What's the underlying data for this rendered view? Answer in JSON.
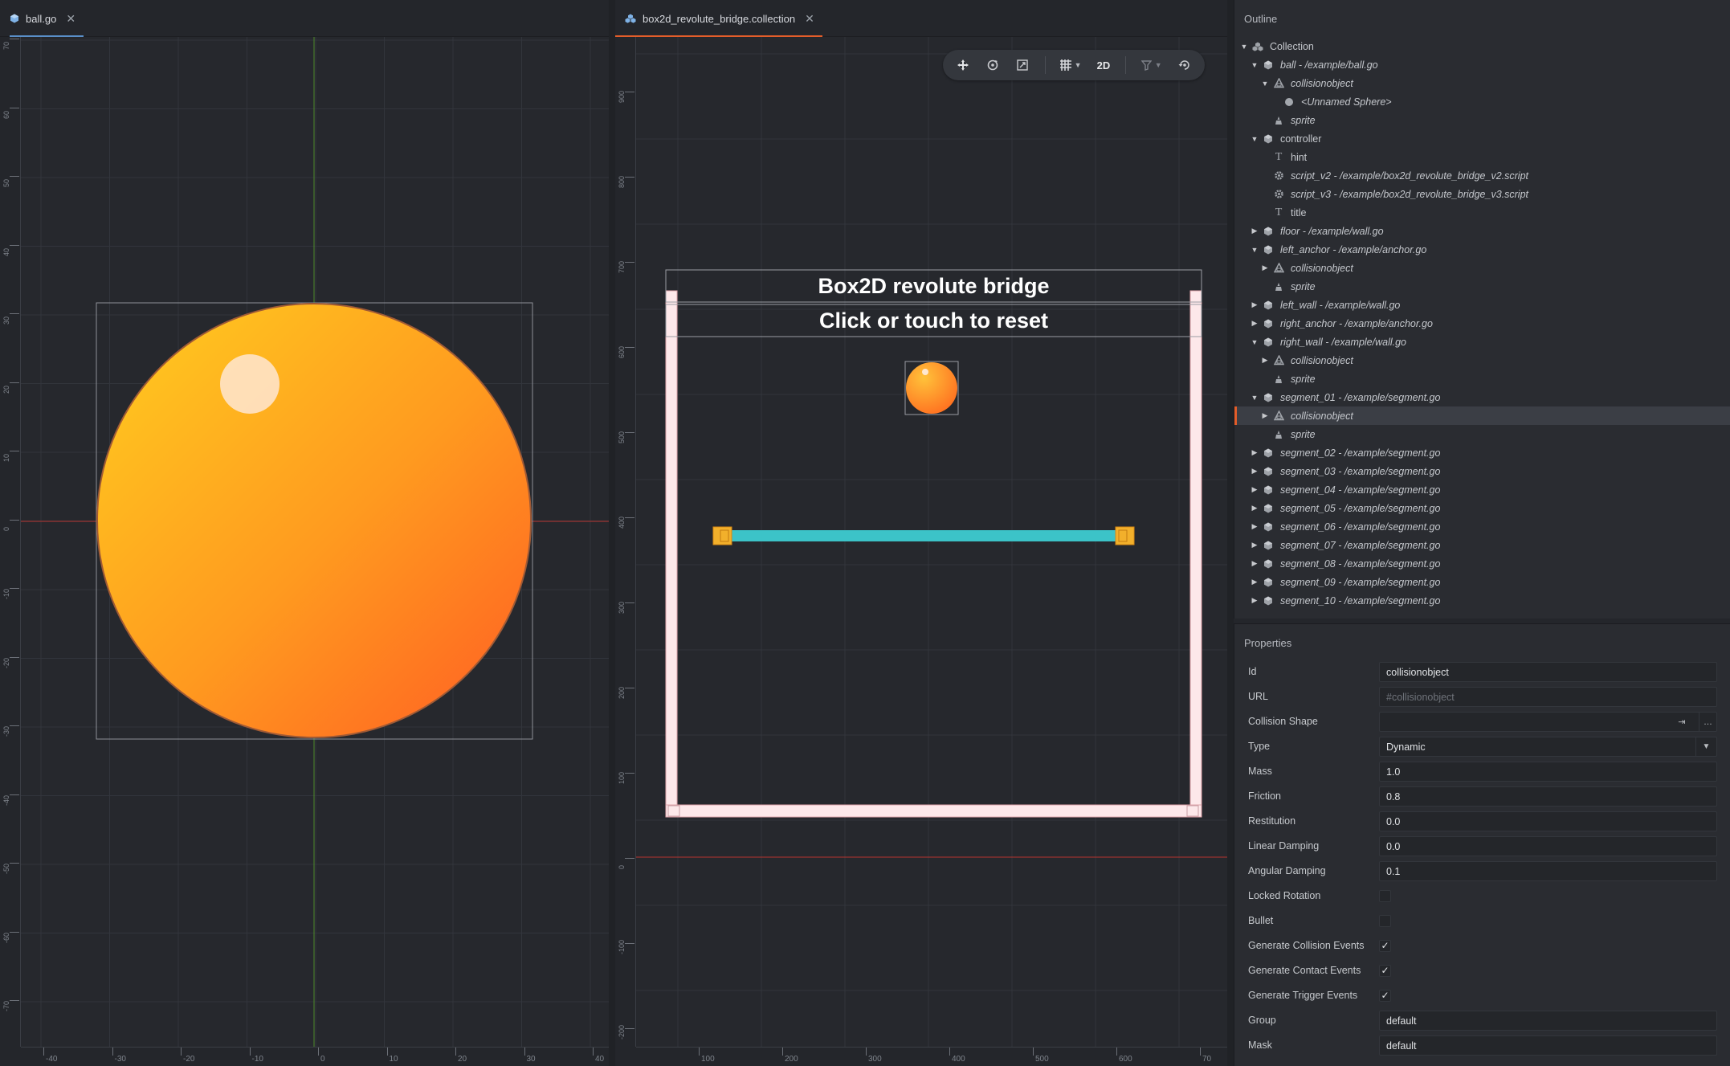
{
  "tabs": {
    "ball": {
      "label": "ball.go",
      "close": "✕"
    },
    "collection": {
      "label": "box2d_revolute_bridge.collection",
      "close": "✕"
    }
  },
  "ball_view": {
    "ruler_y": [
      "70",
      "60",
      "50",
      "40",
      "30",
      "20",
      "10",
      "0",
      "-10",
      "-20",
      "-30",
      "-40",
      "-50",
      "-60",
      "-70"
    ],
    "ruler_x": [
      "-40",
      "-30",
      "-20",
      "-10",
      "0",
      "10",
      "20",
      "30",
      "40"
    ]
  },
  "collection_view": {
    "ruler_y": [
      "900",
      "800",
      "700",
      "600",
      "500",
      "400",
      "300",
      "200",
      "100",
      "0",
      "-100",
      "-200"
    ],
    "ruler_x": [
      "100",
      "200",
      "300",
      "400",
      "500",
      "600",
      "70"
    ],
    "game_title": "Box2D revolute bridge",
    "game_hint": "Click or touch to reset"
  },
  "toolbar": {
    "move_icon": "move-icon",
    "rotate_icon": "rotate-icon",
    "scale_icon": "scale-icon",
    "grid_icon": "grid-icon",
    "mode_label": "2D",
    "visibility_icon": "filter-icon",
    "camera_icon": "camera-reset-icon"
  },
  "outline": {
    "title": "Outline",
    "items": [
      {
        "label": "Collection",
        "depth": 0,
        "arrow": "▼",
        "icon": "collection",
        "italic": false
      },
      {
        "label": "ball - /example/ball.go",
        "depth": 1,
        "arrow": "▼",
        "icon": "go",
        "italic": true
      },
      {
        "label": "collisionobject",
        "depth": 2,
        "arrow": "▼",
        "icon": "collision",
        "italic": true
      },
      {
        "label": "<Unnamed Sphere>",
        "depth": 3,
        "arrow": "",
        "icon": "sphere",
        "italic": true
      },
      {
        "label": "sprite",
        "depth": 2,
        "arrow": "",
        "icon": "sprite",
        "italic": true
      },
      {
        "label": "controller",
        "depth": 1,
        "arrow": "▼",
        "icon": "go",
        "italic": false
      },
      {
        "label": "hint",
        "depth": 2,
        "arrow": "",
        "icon": "text",
        "italic": false
      },
      {
        "label": "script_v2 - /example/box2d_revolute_bridge_v2.script",
        "depth": 2,
        "arrow": "",
        "icon": "script",
        "italic": true
      },
      {
        "label": "script_v3 - /example/box2d_revolute_bridge_v3.script",
        "depth": 2,
        "arrow": "",
        "icon": "script",
        "italic": true
      },
      {
        "label": "title",
        "depth": 2,
        "arrow": "",
        "icon": "text",
        "italic": false
      },
      {
        "label": "floor - /example/wall.go",
        "depth": 1,
        "arrow": "▶",
        "icon": "go",
        "italic": true
      },
      {
        "label": "left_anchor - /example/anchor.go",
        "depth": 1,
        "arrow": "▼",
        "icon": "go",
        "italic": true
      },
      {
        "label": "collisionobject",
        "depth": 2,
        "arrow": "▶",
        "icon": "collision",
        "italic": true
      },
      {
        "label": "sprite",
        "depth": 2,
        "arrow": "",
        "icon": "sprite",
        "italic": true
      },
      {
        "label": "left_wall - /example/wall.go",
        "depth": 1,
        "arrow": "▶",
        "icon": "go",
        "italic": true
      },
      {
        "label": "right_anchor - /example/anchor.go",
        "depth": 1,
        "arrow": "▶",
        "icon": "go",
        "italic": true
      },
      {
        "label": "right_wall - /example/wall.go",
        "depth": 1,
        "arrow": "▼",
        "icon": "go",
        "italic": true
      },
      {
        "label": "collisionobject",
        "depth": 2,
        "arrow": "▶",
        "icon": "collision",
        "italic": true
      },
      {
        "label": "sprite",
        "depth": 2,
        "arrow": "",
        "icon": "sprite",
        "italic": true
      },
      {
        "label": "segment_01 - /example/segment.go",
        "depth": 1,
        "arrow": "▼",
        "icon": "go",
        "italic": true
      },
      {
        "label": "collisionobject",
        "depth": 2,
        "arrow": "▶",
        "icon": "collision",
        "italic": true,
        "selected": true
      },
      {
        "label": "sprite",
        "depth": 2,
        "arrow": "",
        "icon": "sprite",
        "italic": true
      },
      {
        "label": "segment_02 - /example/segment.go",
        "depth": 1,
        "arrow": "▶",
        "icon": "go",
        "italic": true
      },
      {
        "label": "segment_03 - /example/segment.go",
        "depth": 1,
        "arrow": "▶",
        "icon": "go",
        "italic": true
      },
      {
        "label": "segment_04 - /example/segment.go",
        "depth": 1,
        "arrow": "▶",
        "icon": "go",
        "italic": true
      },
      {
        "label": "segment_05 - /example/segment.go",
        "depth": 1,
        "arrow": "▶",
        "icon": "go",
        "italic": true
      },
      {
        "label": "segment_06 - /example/segment.go",
        "depth": 1,
        "arrow": "▶",
        "icon": "go",
        "italic": true
      },
      {
        "label": "segment_07 - /example/segment.go",
        "depth": 1,
        "arrow": "▶",
        "icon": "go",
        "italic": true
      },
      {
        "label": "segment_08 - /example/segment.go",
        "depth": 1,
        "arrow": "▶",
        "icon": "go",
        "italic": true
      },
      {
        "label": "segment_09 - /example/segment.go",
        "depth": 1,
        "arrow": "▶",
        "icon": "go",
        "italic": true
      },
      {
        "label": "segment_10 - /example/segment.go",
        "depth": 1,
        "arrow": "▶",
        "icon": "go",
        "italic": true
      }
    ]
  },
  "properties": {
    "title": "Properties",
    "rows": [
      {
        "label": "Id",
        "kind": "text",
        "value": "collisionobject"
      },
      {
        "label": "URL",
        "kind": "placeholder",
        "value": "#collisionobject"
      },
      {
        "label": "Collision Shape",
        "kind": "resource",
        "value": ""
      },
      {
        "label": "Type",
        "kind": "select",
        "value": "Dynamic"
      },
      {
        "label": "Mass",
        "kind": "text",
        "value": "1.0"
      },
      {
        "label": "Friction",
        "kind": "text",
        "value": "0.8"
      },
      {
        "label": "Restitution",
        "kind": "text",
        "value": "0.0"
      },
      {
        "label": "Linear Damping",
        "kind": "text",
        "value": "0.0"
      },
      {
        "label": "Angular Damping",
        "kind": "text",
        "value": "0.1"
      },
      {
        "label": "Locked Rotation",
        "kind": "check",
        "value": ""
      },
      {
        "label": "Bullet",
        "kind": "check",
        "value": ""
      },
      {
        "label": "Generate Collision Events",
        "kind": "check",
        "value": "✓"
      },
      {
        "label": "Generate Contact Events",
        "kind": "check",
        "value": "✓"
      },
      {
        "label": "Generate Trigger Events",
        "kind": "check",
        "value": "✓"
      },
      {
        "label": "Group",
        "kind": "text",
        "value": "default"
      },
      {
        "label": "Mask",
        "kind": "text",
        "value": "default"
      }
    ]
  },
  "colors": {
    "accent": "#e35d2a",
    "ball_orange": "#ff9a1f",
    "bridge_cyan": "#3cc3c8",
    "anchor_yellow": "#f2b02b",
    "axis_red": "#b5352f",
    "axis_green": "#4d8a2a"
  }
}
